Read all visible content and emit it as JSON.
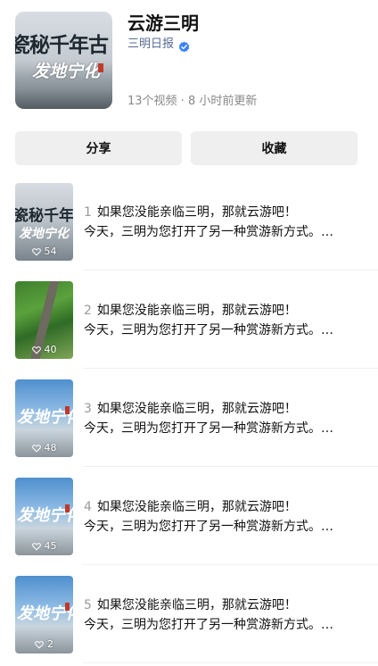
{
  "header": {
    "title": "云游三明",
    "author": "三明日报",
    "meta": "13个视频 · 8 小时前更新",
    "cover_text_line1": "瓷秘千年古",
    "cover_text_line2": "发地宁化"
  },
  "actions": {
    "share_label": "分享",
    "favorite_label": "收藏"
  },
  "videos": [
    {
      "num": "1",
      "title": "如果您没能亲临三明，那就云游吧！",
      "desc": "今天，三明为您打开了另一种赏游新方式。…",
      "likes": "54",
      "thumb_style": "stone",
      "thumb_text1": "瓷秘千年古",
      "thumb_text2": "发地宁化"
    },
    {
      "num": "2",
      "title": "如果您没能亲临三明，那就云游吧！",
      "desc": "今天，三明为您打开了另一种赏游新方式。…",
      "likes": "40",
      "thumb_style": "forest",
      "thumb_text1": "",
      "thumb_text2": ""
    },
    {
      "num": "3",
      "title": "如果您没能亲临三明，那就云游吧！",
      "desc": "今天，三明为您打开了另一种赏游新方式。…",
      "likes": "48",
      "thumb_style": "sky",
      "thumb_text1": "发地宁化",
      "thumb_text2": ""
    },
    {
      "num": "4",
      "title": "如果您没能亲临三明，那就云游吧！",
      "desc": "今天，三明为您打开了另一种赏游新方式。…",
      "likes": "45",
      "thumb_style": "sky",
      "thumb_text1": "发地宁化",
      "thumb_text2": ""
    },
    {
      "num": "5",
      "title": "如果您没能亲临三明，那就云游吧！",
      "desc": "今天，三明为您打开了另一种赏游新方式。…",
      "likes": "2",
      "thumb_style": "sky",
      "thumb_text1": "发地宁化",
      "thumb_text2": ""
    }
  ],
  "colors": {
    "author_link": "#576b95",
    "verified_badge": "#3b82f6",
    "button_bg": "#efefef",
    "meta_text": "#888888"
  },
  "icons": {
    "verified": "verified-badge-icon",
    "likes": "heart-icon"
  }
}
